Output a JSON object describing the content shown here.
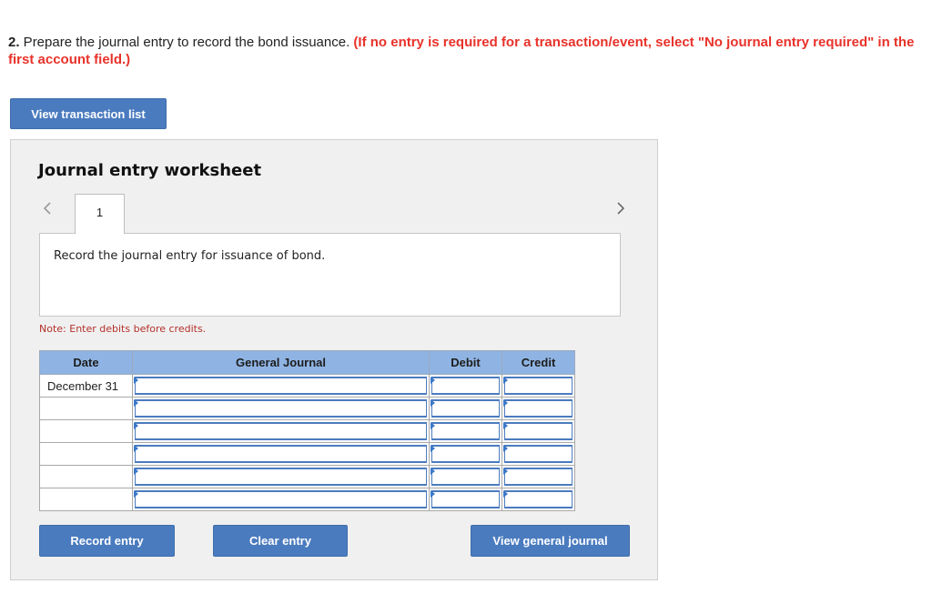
{
  "question": {
    "number": "2.",
    "text": " Prepare the journal entry to record the bond issuance. ",
    "instruction": "(If no entry is required for a transaction/event, select \"No journal entry required\" in the first account field.)"
  },
  "buttons": {
    "view_transaction_list": "View transaction list",
    "record_entry": "Record entry",
    "clear_entry": "Clear entry",
    "view_general_journal": "View general journal"
  },
  "worksheet": {
    "title": "Journal entry worksheet",
    "current_page": "1",
    "nav_prev_icon": "chevron-left-icon",
    "nav_next_icon": "chevron-right-icon",
    "description": "Record the journal entry for issuance of bond.",
    "note": "Note: Enter debits before credits."
  },
  "journal": {
    "columns": [
      "Date",
      "General Journal",
      "Debit",
      "Credit"
    ],
    "rows": [
      {
        "date": "December 31",
        "account": "",
        "debit": "",
        "credit": ""
      },
      {
        "date": "",
        "account": "",
        "debit": "",
        "credit": ""
      },
      {
        "date": "",
        "account": "",
        "debit": "",
        "credit": ""
      },
      {
        "date": "",
        "account": "",
        "debit": "",
        "credit": ""
      },
      {
        "date": "",
        "account": "",
        "debit": "",
        "credit": ""
      },
      {
        "date": "",
        "account": "",
        "debit": "",
        "credit": ""
      }
    ]
  },
  "colors": {
    "button_blue": "#4a7bbf",
    "header_blue": "#8fb4e3",
    "instruction_red": "#e8322a",
    "note_red": "#b5312b"
  }
}
